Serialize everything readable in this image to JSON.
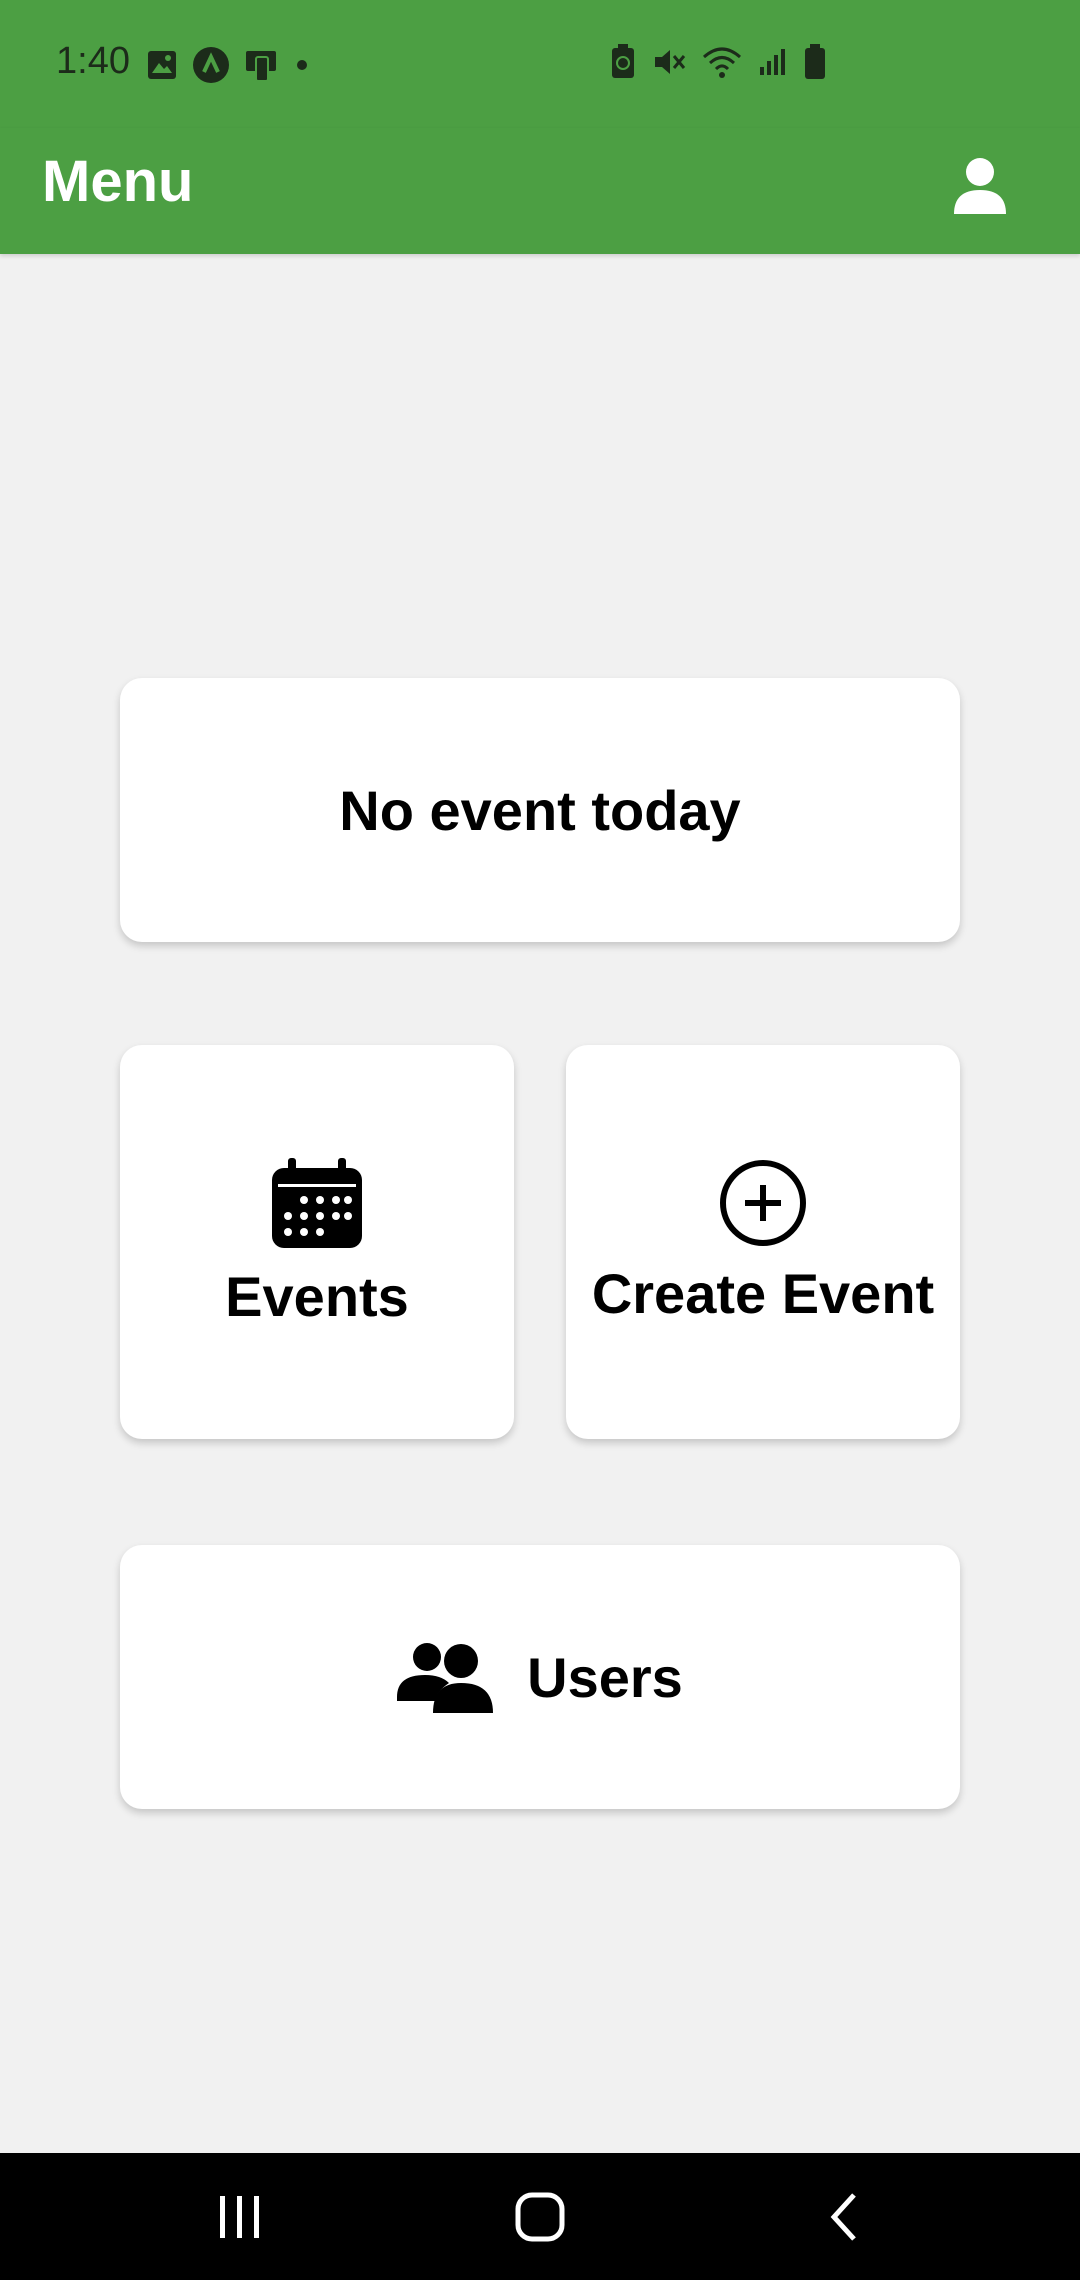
{
  "status_bar": {
    "time": "1:40",
    "left_icons": [
      "image-icon",
      "app-a-icon",
      "cast-icon",
      "dot-icon"
    ],
    "right_icons": [
      "battery-saver-icon",
      "mute-icon",
      "wifi-icon",
      "signal-icon",
      "battery-icon"
    ]
  },
  "app_bar": {
    "title": "Menu",
    "profile_icon": "person-icon",
    "background_color": "#4c9f43"
  },
  "cards": {
    "today_message": "No event today",
    "events_label": "Events",
    "events_icon": "calendar-icon",
    "create_event_label": "Create Event",
    "create_event_icon": "plus-circle-icon",
    "users_label": "Users",
    "users_icon": "users-icon"
  },
  "nav_bar": {
    "buttons": [
      "recent-apps-icon",
      "home-icon",
      "back-icon"
    ]
  }
}
